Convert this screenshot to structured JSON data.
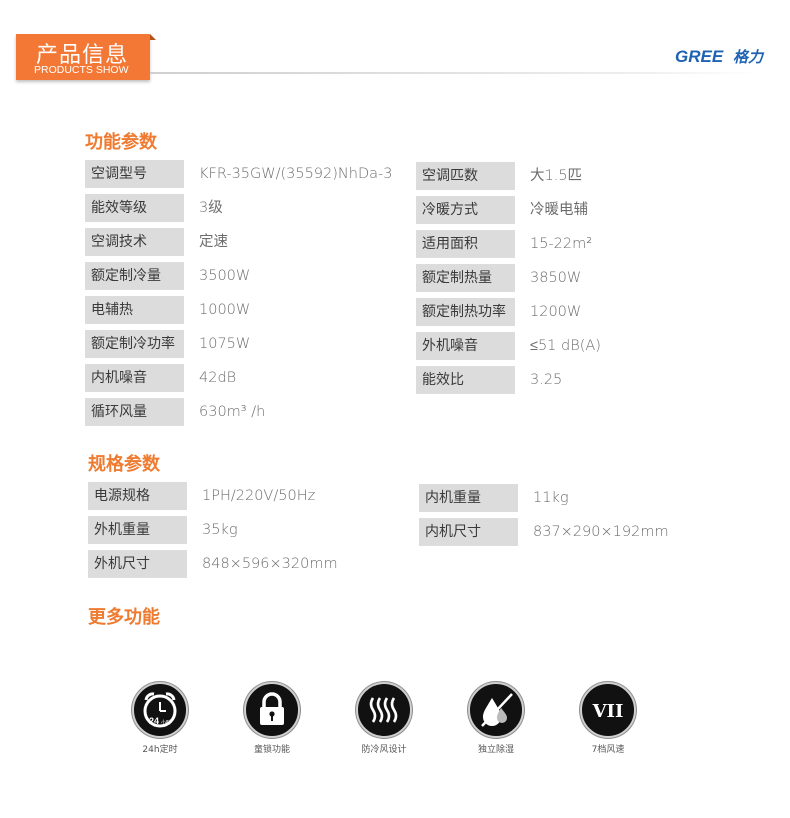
{
  "header": {
    "title": "产品信息",
    "subtitle": "PRODUCTS SHOW",
    "brand_logo": "GREE 格力",
    "accent": "#f37735"
  },
  "sections": [
    {
      "title": "功能参数",
      "left": [
        {
          "label": "空调型号",
          "value": "KFR-35GW/(35592)NhDa-3"
        },
        {
          "label": "能效等级",
          "value": "3级"
        },
        {
          "label": "空调技术",
          "value": "定速"
        },
        {
          "label": "额定制冷量",
          "value": "3500W"
        },
        {
          "label": "电辅热",
          "value": "1000W"
        },
        {
          "label": "额定制冷功率",
          "value": "1075W"
        },
        {
          "label": "内机噪音",
          "value": "42dB"
        },
        {
          "label": "循环风量",
          "value": "630m³ /h"
        }
      ],
      "right": [
        {
          "label": "空调匹数",
          "value": "大1.5匹"
        },
        {
          "label": "冷暖方式",
          "value": "冷暖电辅"
        },
        {
          "label": "适用面积",
          "value": "15-22m²"
        },
        {
          "label": "额定制热量",
          "value": "3850W"
        },
        {
          "label": "额定制热功率",
          "value": "1200W"
        },
        {
          "label": "外机噪音",
          "value": "≤51 dB(A)"
        },
        {
          "label": "能效比",
          "value": "3.25"
        }
      ]
    },
    {
      "title": "规格参数",
      "left": [
        {
          "label": "电源规格",
          "value": "1PH/220V/50Hz"
        },
        {
          "label": "外机重量",
          "value": "35kg"
        },
        {
          "label": "外机尺寸",
          "value": "848×596×320mm"
        }
      ],
      "right": [
        {
          "label": "内机重量",
          "value": "11kg"
        },
        {
          "label": "内机尺寸",
          "value": "837×290×192mm"
        }
      ]
    }
  ],
  "more": {
    "title": "更多功能",
    "features": [
      {
        "icon": "alarm-clock-icon",
        "badge": "24",
        "badge_small": "小时",
        "caption": "24h定时"
      },
      {
        "icon": "padlock-icon",
        "caption": "童锁功能"
      },
      {
        "icon": "heat-waves-icon",
        "caption": "防冷风设计"
      },
      {
        "icon": "no-humidity-icon",
        "caption": "独立除湿"
      },
      {
        "icon": "fan-speed-icon",
        "badge": "VII",
        "caption": "7档风速"
      }
    ]
  }
}
